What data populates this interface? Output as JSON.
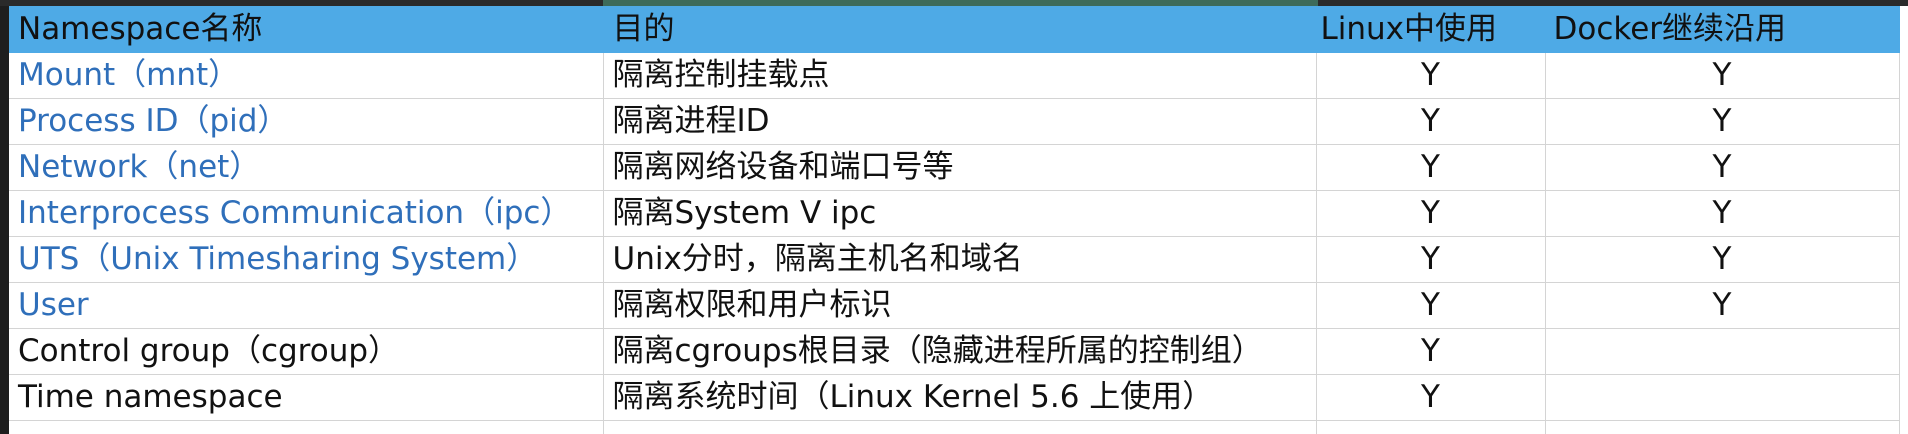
{
  "table": {
    "headers": [
      "Namespace名称",
      "目的",
      "Linux中使用",
      "Docker继续沿用"
    ],
    "rows": [
      {
        "name": "Mount（mnt）",
        "purpose": "隔离控制挂载点",
        "linux": "Y",
        "docker": "Y",
        "link": true
      },
      {
        "name": "Process ID（pid）",
        "purpose": "隔离进程ID",
        "linux": "Y",
        "docker": "Y",
        "link": true
      },
      {
        "name": "Network（net）",
        "purpose": "隔离网络设备和端口号等",
        "linux": "Y",
        "docker": "Y",
        "link": true
      },
      {
        "name": "Interprocess Communication（ipc）",
        "purpose": "隔离System V ipc",
        "linux": "Y",
        "docker": "Y",
        "link": true
      },
      {
        "name": "UTS（Unix Timesharing System）",
        "purpose": "Unix分时，隔离主机名和域名",
        "linux": "Y",
        "docker": "Y",
        "link": true
      },
      {
        "name": "User",
        "purpose": "隔离权限和用户标识",
        "linux": "Y",
        "docker": "Y",
        "link": true
      },
      {
        "name": "Control group（cgroup）",
        "purpose": "隔离cgroups根目录（隐藏进程所属的控制组）",
        "linux": "Y",
        "docker": "",
        "link": false
      },
      {
        "name": "Time namespace",
        "purpose": "隔离系统时间（Linux Kernel 5.6 上使用）",
        "linux": "Y",
        "docker": "",
        "link": false
      }
    ]
  },
  "colors": {
    "header_bg": "#4eaae6",
    "link_text": "#2f6fba",
    "gridline": "#d4d4d4"
  }
}
